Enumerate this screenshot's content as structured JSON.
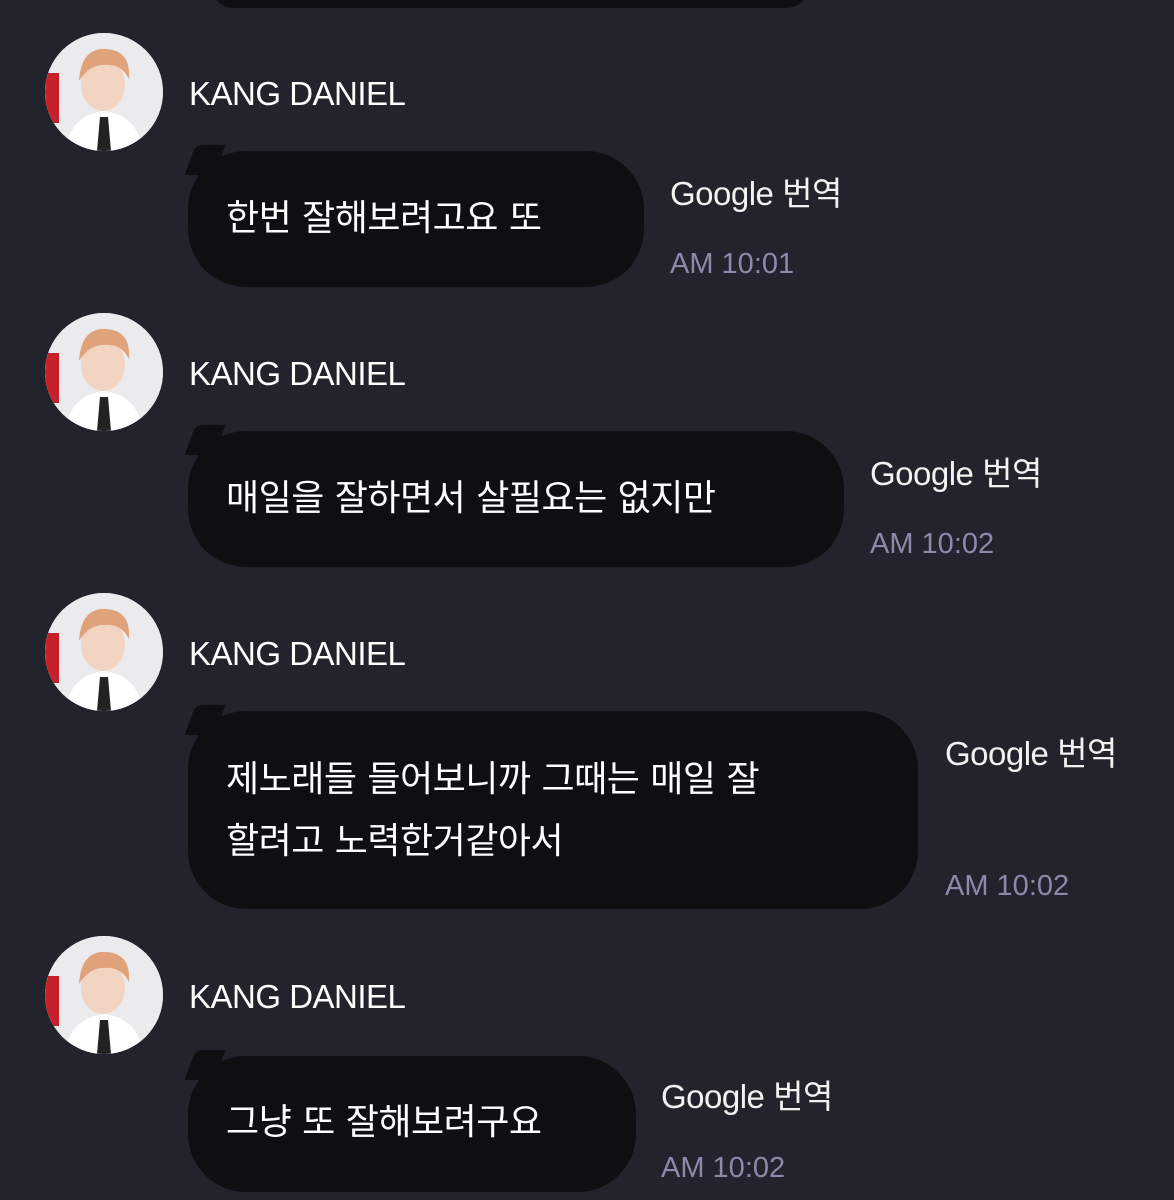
{
  "colors": {
    "background": "#23232d",
    "bubble": "#0f0f13",
    "message_text": "#ffffff",
    "timestamp": "#8d89a8"
  },
  "messages": [
    {
      "sender": "KANG DANIEL",
      "text": "한번 잘해보려고요  또",
      "translate_label": "Google 번역",
      "time": "AM 10:01"
    },
    {
      "sender": "KANG DANIEL",
      "text": "매일을 잘하면서 살필요는 없지만",
      "translate_label": "Google 번역",
      "time": "AM 10:02"
    },
    {
      "sender": "KANG DANIEL",
      "text": "제노래들 들어보니까 그때는 매일 잘\n할려고 노력한거같아서",
      "translate_label": "Google 번역",
      "time": "AM 10:02"
    },
    {
      "sender": "KANG DANIEL",
      "text": "그냥 또 잘해보려구요",
      "translate_label": "Google 번역",
      "time": "AM 10:02"
    }
  ]
}
